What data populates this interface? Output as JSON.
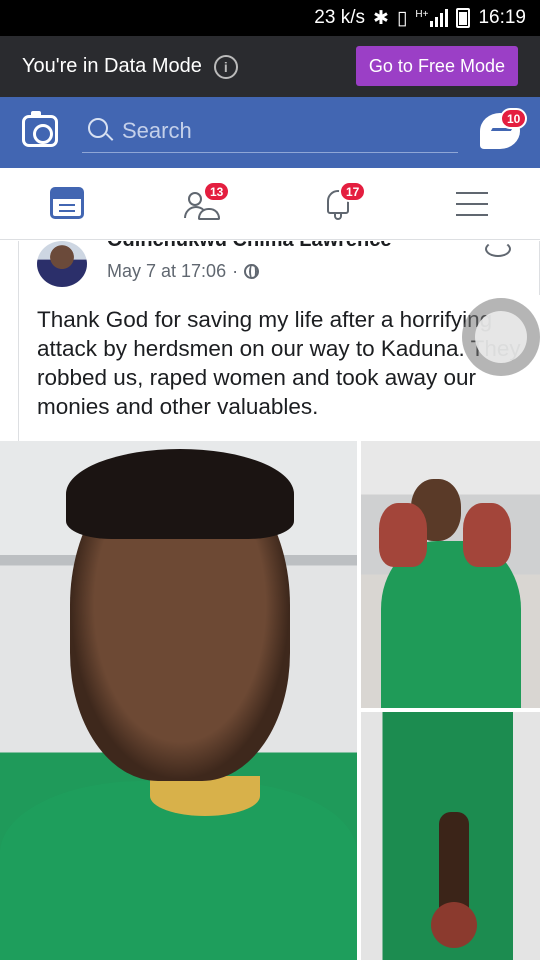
{
  "status_bar": {
    "speed": "23 k/s",
    "network": "H+",
    "time": "16:19"
  },
  "data_mode_banner": {
    "text": "You're in Data Mode",
    "button_label": "Go to Free Mode",
    "button_color": "#9b3fc6"
  },
  "top_bar": {
    "search_placeholder": "Search",
    "messenger_badge": "10",
    "brand_color": "#4266b2"
  },
  "nav": {
    "friends_badge": "13",
    "notifications_badge": "17",
    "icons": [
      "news-feed-icon",
      "friend-requests-icon",
      "notifications-icon",
      "menu-icon"
    ]
  },
  "post": {
    "author": "Odinchukwu Chima Lawrence",
    "timestamp": "May 7 at 17:06",
    "separator": "·",
    "text": "Thank God for saving my life after a horrifying attack by herdsmen on our way to Kaduna. They robbed us, raped women and took away our monies and other valuables.",
    "photo_count": 3
  }
}
